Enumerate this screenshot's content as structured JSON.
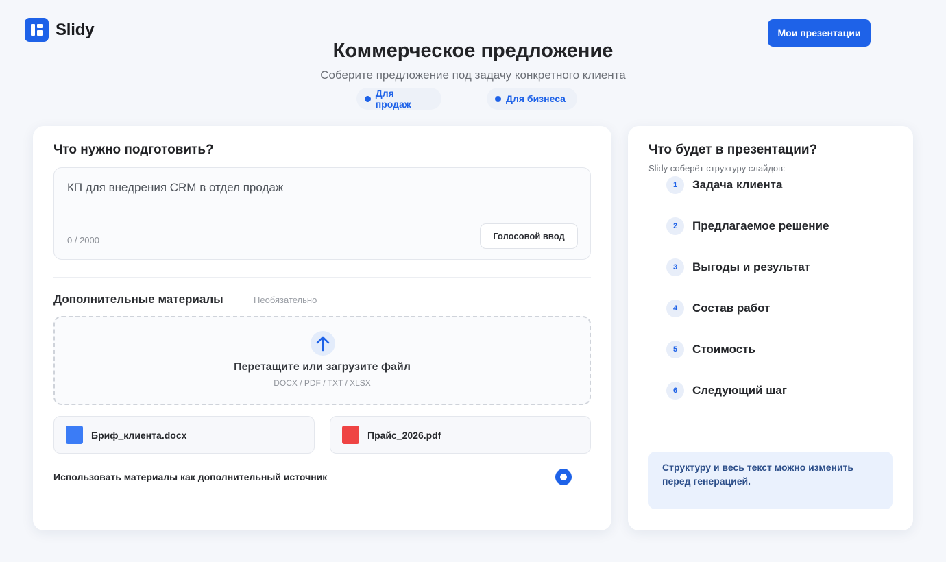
{
  "app": {
    "name": "Slidy"
  },
  "header": {
    "my_presentations_label": "Мои презентации"
  },
  "hero": {
    "title": "Коммерческое предложение",
    "subtitle": "Соберите предложение под задачу конкретного клиента",
    "tags": [
      "Для продаж",
      "Для бизнеса"
    ]
  },
  "form": {
    "task_title": "Что нужно подготовить?",
    "task_value": "КП для внедрения CRM в отдел продаж",
    "counter": "0 / 2000",
    "voice_label": "Голосовой ввод",
    "materials_title": "Дополнительные материалы",
    "materials_optional": "Необязательно",
    "drop_text": "Перетащите или загрузите файл",
    "drop_types": "DOCX / PDF / TXT / XLSX",
    "files": [
      {
        "name": "Бриф_клиента.docx",
        "color": "#3b7cf6"
      },
      {
        "name": "Прайс_2026.pdf",
        "color": "#ef4444"
      }
    ],
    "use_materials_label": "Использовать материалы как дополнительный источник",
    "use_materials_checked": true
  },
  "outline": {
    "title": "Что будет в презентации?",
    "subtitle": "Slidy соберёт структуру слайдов:",
    "steps": [
      {
        "num": "1",
        "label": "Задача клиента"
      },
      {
        "num": "2",
        "label": "Предлагаемое решение"
      },
      {
        "num": "3",
        "label": "Выгоды и результат"
      },
      {
        "num": "4",
        "label": "Состав работ"
      },
      {
        "num": "5",
        "label": "Стоимость"
      },
      {
        "num": "6",
        "label": "Следующий шаг"
      }
    ],
    "note": "Структуру и весь текст можно изменить перед генерацией."
  },
  "colors": {
    "accent": "#1e62e8",
    "background": "#f5f7fb"
  }
}
